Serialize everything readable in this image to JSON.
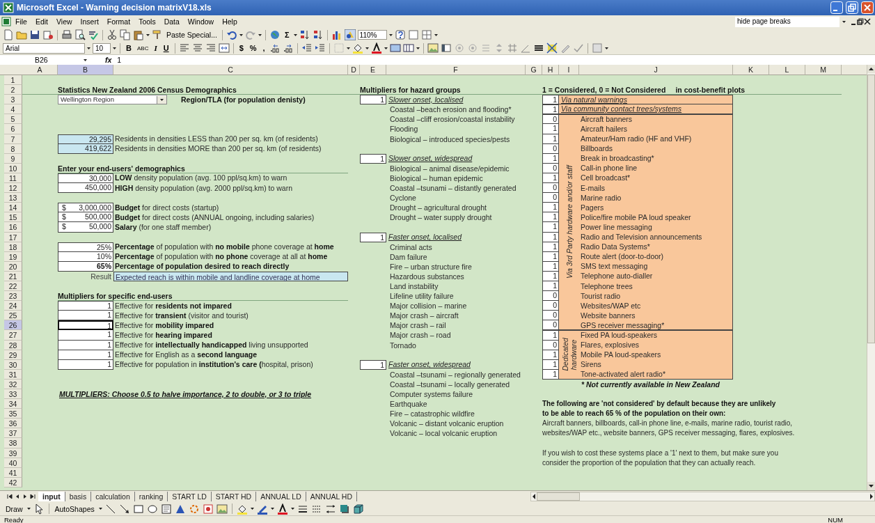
{
  "window": {
    "title": "Microsoft Excel - Warning decision matrixV18.xls"
  },
  "menu": {
    "items": [
      "File",
      "Edit",
      "View",
      "Insert",
      "Format",
      "Tools",
      "Data",
      "Window",
      "Help"
    ],
    "help_box": "hide page breaks"
  },
  "standard_toolbar": {
    "paste_special": "Paste Special...",
    "autosum": "Σ",
    "zoom": "110%"
  },
  "formatting_toolbar": {
    "font": "Arial",
    "font_size": "10",
    "bold": "B",
    "strikethrough": "ABC",
    "italic": "I",
    "underline": "U",
    "currency": "$",
    "percent": "%",
    "comma": ","
  },
  "formula_bar": {
    "cell": "B26",
    "function": "fx",
    "value": "1"
  },
  "columns": [
    {
      "label": "A",
      "selected": false
    },
    {
      "label": "B",
      "selected": true
    },
    {
      "label": "C",
      "selected": false
    },
    {
      "label": "D",
      "selected": false
    },
    {
      "label": "E",
      "selected": false
    },
    {
      "label": "F",
      "selected": false
    },
    {
      "label": "G",
      "selected": false
    },
    {
      "label": "H",
      "selected": false
    },
    {
      "label": "I",
      "selected": false
    },
    {
      "label": "J",
      "selected": false
    },
    {
      "label": "K",
      "selected": false
    },
    {
      "label": "L",
      "selected": false
    },
    {
      "label": "M",
      "selected": false
    }
  ],
  "rows": [
    {
      "label": "1",
      "selected": false
    },
    {
      "label": "2",
      "selected": false
    },
    {
      "label": "3",
      "selected": false
    },
    {
      "label": "4",
      "selected": false
    },
    {
      "label": "5",
      "selected": false
    },
    {
      "label": "6",
      "selected": false
    },
    {
      "label": "7",
      "selected": false
    },
    {
      "label": "8",
      "selected": false
    },
    {
      "label": "9",
      "selected": false
    },
    {
      "label": "10",
      "selected": false
    },
    {
      "label": "11",
      "selected": false
    },
    {
      "label": "12",
      "selected": false
    },
    {
      "label": "13",
      "selected": false
    },
    {
      "label": "14",
      "selected": false
    },
    {
      "label": "15",
      "selected": false
    },
    {
      "label": "16",
      "selected": false
    },
    {
      "label": "17",
      "selected": false
    },
    {
      "label": "18",
      "selected": false
    },
    {
      "label": "19",
      "selected": false
    },
    {
      "label": "20",
      "selected": false
    },
    {
      "label": "21",
      "selected": false
    },
    {
      "label": "22",
      "selected": false
    },
    {
      "label": "23",
      "selected": false
    },
    {
      "label": "24",
      "selected": false
    },
    {
      "label": "25",
      "selected": false
    },
    {
      "label": "26",
      "selected": true
    },
    {
      "label": "27",
      "selected": false
    },
    {
      "label": "28",
      "selected": false
    },
    {
      "label": "29",
      "selected": false
    },
    {
      "label": "30",
      "selected": false
    },
    {
      "label": "31",
      "selected": false
    },
    {
      "label": "32",
      "selected": false
    },
    {
      "label": "33",
      "selected": false
    },
    {
      "label": "34",
      "selected": false
    },
    {
      "label": "35",
      "selected": false
    },
    {
      "label": "36",
      "selected": false
    },
    {
      "label": "37",
      "selected": false
    },
    {
      "label": "38",
      "selected": false
    },
    {
      "label": "39",
      "selected": false
    },
    {
      "label": "40",
      "selected": false
    },
    {
      "label": "41",
      "selected": false
    },
    {
      "label": "42",
      "selected": false
    }
  ],
  "census": {
    "heading": "Statistics New Zealand 2006 Census Demographics",
    "region": "Wellington Region",
    "region_label": "Region/TLA (for population denisty)",
    "residents": [
      {
        "count": "29,295",
        "description": "Residents in densities LESS than 200 per sq. km (of residents)"
      },
      {
        "count": "419,622",
        "description": "Residents in densities MORE than 200 per sq. km (of residents)"
      }
    ]
  },
  "end_users": {
    "heading": "Enter your end-users' demographics",
    "populations": [
      {
        "count": "30,000",
        "description": "**LOW** density population (avg. 100 ppl/sq.km) to warn"
      },
      {
        "count": "450,000",
        "description": "**HIGH** density population (avg. 2000 ppl/sq.km) to warn"
      }
    ],
    "budgets": [
      {
        "currency": "$",
        "amount": "3,000,000",
        "description": "**Budget** for direct costs (startup)"
      },
      {
        "currency": "$",
        "amount": "500,000",
        "description": "**Budget** for direct costs (ANNUAL ongoing, including salaries)"
      },
      {
        "currency": "$",
        "amount": "50,000",
        "description": "**Salary** (for one staff member)"
      }
    ],
    "percentages": [
      {
        "kind": "input",
        "percentage": "25%",
        "description": "**Percentage** of population with **no mobile** phone coverage at **home**"
      },
      {
        "kind": "input",
        "percentage": "10%",
        "description": "**Percentage** of population with **no phone** coverage at all at **home**"
      },
      {
        "kind": "target",
        "percentage": "65%",
        "description": "Percentage of population desired to reach directly"
      }
    ],
    "result": {
      "label": "Result",
      "value": "Expected reach is within mobile and landline coverage at home"
    }
  },
  "multipliers": {
    "heading": "Multipliers for specific end-users",
    "items": [
      {
        "multiplier": "1",
        "description": "Effective for **residents not impared**",
        "selected": false
      },
      {
        "multiplier": "1",
        "description": "Effective for **transient** (visitor and tourist)",
        "selected": false
      },
      {
        "multiplier": "1",
        "description": "Effective for **mobility impared**",
        "selected": true
      },
      {
        "multiplier": "1",
        "description": "Effective for **hearing impared**",
        "selected": false
      },
      {
        "multiplier": "1",
        "description": "Effective for **intellectually handicapped** living unsupported",
        "selected": false
      },
      {
        "multiplier": "1",
        "description": "Effective for English as a **second language**",
        "selected": false
      },
      {
        "multiplier": "1",
        "description": "Effective for population in **institution's care (**hospital, prison)",
        "selected": false
      }
    ],
    "note": "MULTIPLIERS: Choose 0.5 to halve importance, 2 to double, or 3 to triple"
  },
  "hazard_groups": {
    "heading": "Multipliers for hazard groups",
    "groups": [
      {
        "multiplier": "1",
        "name": "Slower onset, localised",
        "hazards": [
          "Coastal –beach erosion and flooding*",
          "Coastal –cliff erosion/coastal instability",
          "Flooding",
          "Biological – introduced species/pests"
        ]
      },
      {
        "multiplier": "1",
        "name": "Slower onset, widespread",
        "hazards": [
          "Biological – animal disease/epidemic",
          "Biological – human epidemic",
          "Coastal –tsunami – distantly generated",
          "Cyclone",
          "Drought – agricultural drought",
          "Drought – water supply drought"
        ]
      },
      {
        "multiplier": "1",
        "name": "Faster onset, localised",
        "hazards": [
          "Criminal acts",
          "Dam failure",
          "Fire – urban structure fire",
          "Hazardous substances",
          "Land instability",
          "Lifeline utility failure",
          "Major collision – marine",
          "Major crash – aircraft",
          "Major crash – rail",
          "Major crash – road",
          "Tornado"
        ]
      },
      {
        "multiplier": "1",
        "name": "Faster onset, widespread",
        "hazards": [
          "Coastal –tsunami – regionally generated",
          "Coastal –tsunami – locally generated",
          "Computer systems failure",
          "Earthquake",
          "Fire – catastrophic wildfire",
          "Volcanic – distant volcanic eruption",
          "Volcanic – local volcanic eruption"
        ]
      }
    ]
  },
  "systems": {
    "heading": "1 = Considered, 0 = Not Considered",
    "heading_note": "in cost-benefit plots",
    "direct": [
      {
        "flag": "1",
        "name": "Via natural warnings"
      },
      {
        "flag": "1",
        "name": "Via community contact trees/systems"
      }
    ],
    "groups": [
      {
        "name": "Via 3rd Party hardware and/or staff",
        "items": [
          {
            "flag": "0",
            "name": "Aircraft banners"
          },
          {
            "flag": "1",
            "name": "Aircraft hailers"
          },
          {
            "flag": "1",
            "name": "Amateur/Ham radio (HF and VHF)"
          },
          {
            "flag": "0",
            "name": "Billboards"
          },
          {
            "flag": "1",
            "name": "Break in broadcasting*"
          },
          {
            "flag": "0",
            "name": "Call-in phone line"
          },
          {
            "flag": "1",
            "name": "Cell broadcast*"
          },
          {
            "flag": "0",
            "name": "E-mails"
          },
          {
            "flag": "0",
            "name": "Marine radio"
          },
          {
            "flag": "1",
            "name": "Pagers"
          },
          {
            "flag": "1",
            "name": "Police/fire mobile PA loud speaker"
          },
          {
            "flag": "1",
            "name": "Power line messaging"
          },
          {
            "flag": "1",
            "name": "Radio and Television announcements"
          },
          {
            "flag": "1",
            "name": "Radio Data Systems*"
          },
          {
            "flag": "1",
            "name": "Route alert (door-to-door)"
          },
          {
            "flag": "1",
            "name": "SMS text messaging"
          },
          {
            "flag": "1",
            "name": "Telephone auto-dialler"
          },
          {
            "flag": "1",
            "name": "Telephone trees"
          },
          {
            "flag": "0",
            "name": "Tourist radio"
          },
          {
            "flag": "0",
            "name": "Websites/WAP etc"
          },
          {
            "flag": "0",
            "name": "Website banners"
          },
          {
            "flag": "0",
            "name": "GPS receiver messaging*"
          }
        ]
      },
      {
        "name": "Dedicated hardware",
        "items": [
          {
            "flag": "1",
            "name": "Fixed PA loud-speakers"
          },
          {
            "flag": "0",
            "name": "Flares, explosives"
          },
          {
            "flag": "1",
            "name": "Mobile PA loud-speakers"
          },
          {
            "flag": "1",
            "name": "Sirens"
          },
          {
            "flag": "1",
            "name": "Tone-activated alert radio*"
          }
        ]
      }
    ],
    "footnote": "* Not currently available in New Zealand",
    "explanation": "The following are 'not considered' by default because they are unlikely\nto be able to reach 65 % of the population on their own:",
    "excluded": "Aircraft banners, billboards, call-in phone line, e-mails, marine radio, tourist radio,\nwebsites/WAP etc., website banners, GPS receiver messaging, flares, explosives.",
    "advice": "If you wish to cost these systems place a '1' next to them, but make sure you\nconsider the proportion of the population that they can actually reach."
  },
  "sheet_tabs": [
    {
      "label": "input",
      "selected": true
    },
    {
      "label": "basis",
      "selected": false
    },
    {
      "label": "calculation",
      "selected": false
    },
    {
      "label": "ranking",
      "selected": false
    },
    {
      "label": "START LD",
      "selected": false
    },
    {
      "label": "START HD",
      "selected": false
    },
    {
      "label": "ANNUAL LD",
      "selected": false
    },
    {
      "label": "ANNUAL HD",
      "selected": false
    }
  ],
  "drawing_toolbar": {
    "draw": "Draw",
    "autoshapes": "AutoShapes"
  },
  "status_bar": {
    "status": "Ready",
    "indicator": "NUM"
  }
}
